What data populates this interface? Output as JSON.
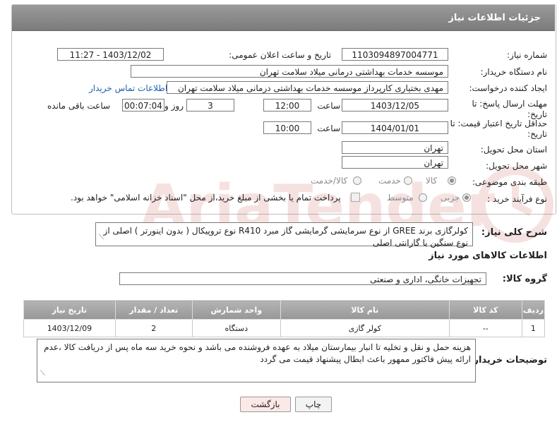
{
  "header": {
    "title": "جزئیات اطلاعات نیاز"
  },
  "form": {
    "need_number": {
      "label": "شماره نیاز:",
      "value": "1103094897004771"
    },
    "announce_datetime": {
      "label": "تاریخ و ساعت اعلان عمومی:",
      "value": "1403/12/02 - 11:27"
    },
    "buyer_org": {
      "label": "نام دستگاه خریدار:",
      "value": "موسسه خدمات بهداشتی درمانی میلاد سلامت تهران"
    },
    "requester": {
      "label": "ایجاد کننده درخواست:",
      "value": "مهدی بختیاری کارپرداز موسسه خدمات بهداشتی درمانی میلاد سلامت تهران",
      "link": "اطلاعات تماس خریدار"
    },
    "reply_deadline": {
      "label_line1": "مهلت ارسال پاسخ: تا",
      "label_line2": "تاریخ:",
      "date": "1403/12/05",
      "time_label": "ساعت",
      "time": "12:00",
      "days": "3",
      "days_label": "روز و",
      "remaining": "00:07:04",
      "remaining_label": "ساعت باقی مانده"
    },
    "price_validity": {
      "label_line1": "حداقل تاریخ اعتبار قیمت: تا",
      "label_line2": "تاریخ:",
      "date": "1404/01/01",
      "time_label": "ساعت",
      "time": "10:00"
    },
    "province": {
      "label": "استان محل تحویل:",
      "value": "تهران"
    },
    "city": {
      "label": "شهر محل تحویل:",
      "value": "تهران"
    },
    "category": {
      "label": "طبقه بندی موضوعی:",
      "options": [
        "کالا",
        "خدمت",
        "کالا/خدمت"
      ],
      "selected": "کالا"
    },
    "process_type": {
      "label": "نوع فرآیند خرید :",
      "options": [
        "جزیی",
        "متوسط"
      ],
      "selected": "جزیی",
      "payment_note": "پرداخت تمام یا بخشی از مبلغ خرید،از محل \"اسناد خزانه اسلامی\" خواهد بود."
    }
  },
  "description": {
    "label": "شرح کلی نیاز:",
    "text": "کولرگازی برند GREE از نوع سرمایشی گرمایشی گاز مبرد R410 نوع تروپیکال ( بدون اینورتر ) اصلی از نوع سنگین با گارانتی اصلی"
  },
  "goods_info": {
    "title": "اطلاعات کالاهای مورد نیاز"
  },
  "goods_group": {
    "label": "گروه کالا:",
    "value": "تجهیزات خانگی، اداری و صنعتی"
  },
  "table": {
    "headers": [
      "ردیف",
      "کد کالا",
      "نام کالا",
      "واحد شمارش",
      "تعداد / مقدار",
      "تاریخ نیاز"
    ],
    "rows": [
      [
        "1",
        "--",
        "کولر گازی",
        "دستگاه",
        "2",
        "1403/12/09"
      ]
    ]
  },
  "buyer_notes": {
    "label": "توضیحات خریدار:",
    "text": "هزینه حمل و نقل و تخلیه تا انبار بیمارستان میلاد به عهده فروشنده می باشد و نحوه خرید سه ماه پس از دریافت کالا ،عدم ارائه پیش فاکتور ممهور باعث ابطال پیشنهاد قیمت می گردد"
  },
  "buttons": {
    "print": "چاپ",
    "back": "بازگشت"
  },
  "watermark": {
    "text": "AriaTender.net",
    "color": "#c0392b"
  }
}
